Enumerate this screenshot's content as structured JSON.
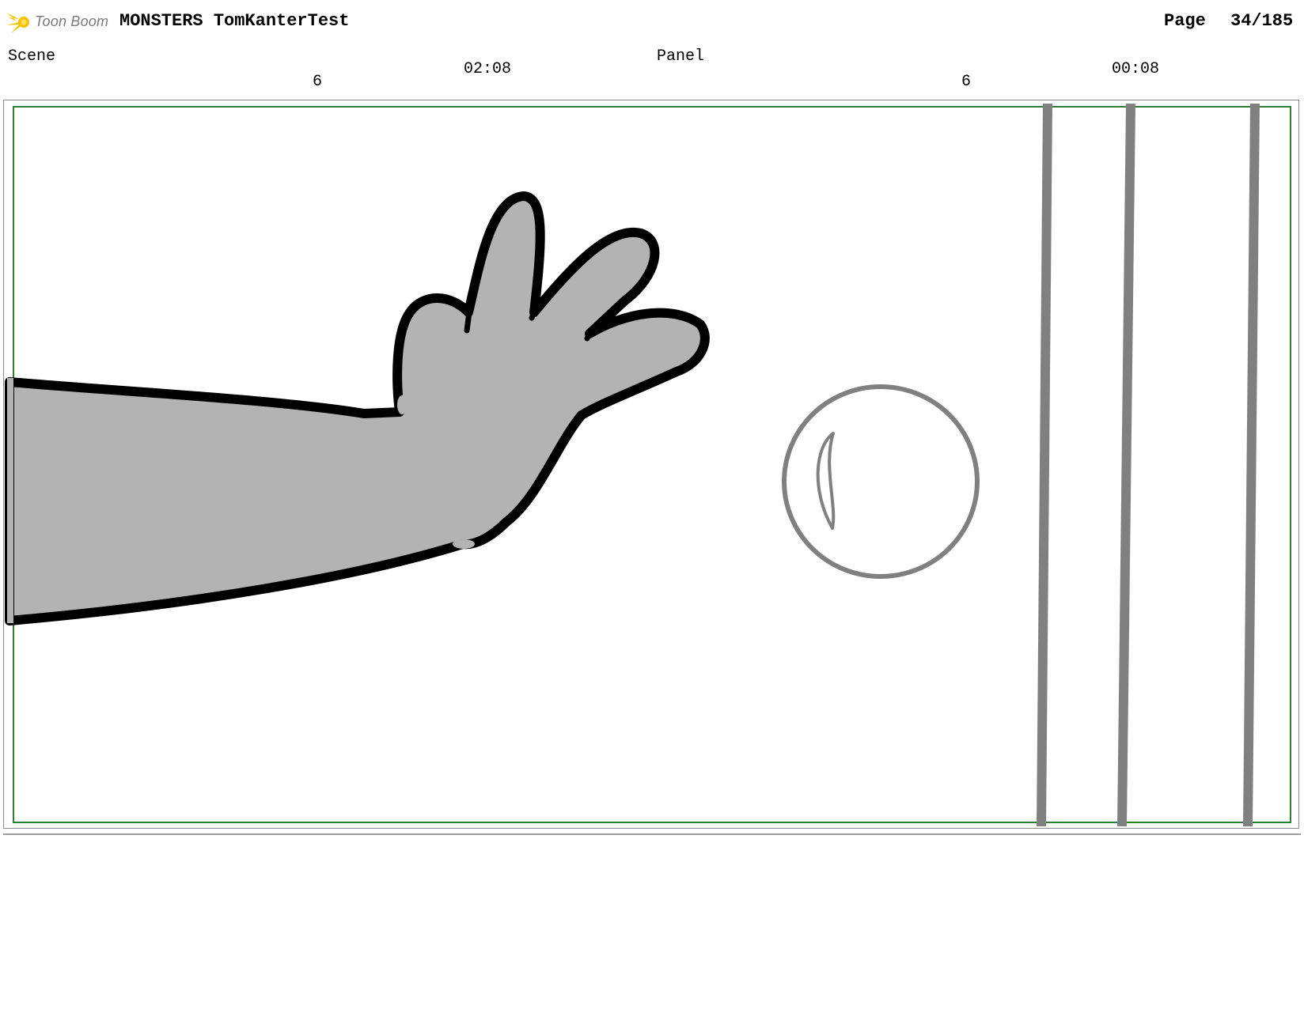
{
  "header": {
    "brand": "Toon Boom",
    "project_title": "MONSTERS TomKanterTest",
    "page_label": "Page",
    "page_value": "34/185"
  },
  "panel_info": {
    "scene_label": "Scene",
    "scene_number": "6",
    "scene_duration": "02:08",
    "panel_label": "Panel",
    "panel_number": "6",
    "panel_duration": "00:08"
  },
  "colors": {
    "safe_frame": "#2e7d32",
    "sketch_fill": "#b3b3b3",
    "sketch_line": "#000000",
    "secondary_line": "#808080",
    "logo_accent": "#f5c400"
  },
  "icons": {
    "logo": "toon-boom-flame-logo"
  }
}
